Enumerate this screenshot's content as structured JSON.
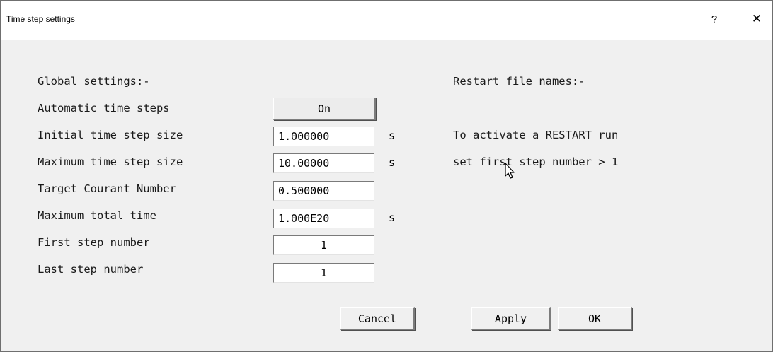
{
  "window": {
    "title": "Time step settings",
    "help_glyph": "?",
    "close_glyph": "✕"
  },
  "global": {
    "heading": "Global settings:-",
    "automatic_label": "Automatic time steps",
    "automatic_value": "On",
    "initial_label": "Initial time step size",
    "initial_value": "1.000000",
    "initial_unit": "s",
    "maximum_label": "Maximum time step size",
    "maximum_value": "10.00000",
    "maximum_unit": "s",
    "courant_label": "Target Courant Number",
    "courant_value": "0.500000",
    "total_label": "Maximum total time",
    "total_value": "1.000E20",
    "total_unit": "s",
    "first_label": "First step number",
    "first_value": "1",
    "last_label": "Last step number",
    "last_value": "1"
  },
  "restart": {
    "heading": "Restart file names:-",
    "line1": "To activate a RESTART run",
    "line2": "set first step number > 1"
  },
  "buttons": {
    "cancel": "Cancel",
    "apply": "Apply",
    "ok": "OK"
  }
}
